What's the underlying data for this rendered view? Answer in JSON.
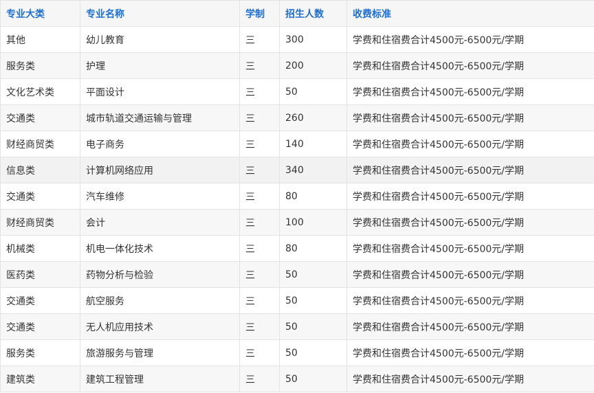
{
  "table": {
    "headers": [
      "专业大类",
      "专业名称",
      "学制",
      "招生人数",
      "收费标准"
    ],
    "rows": [
      [
        "其他",
        "幼儿教育",
        "三",
        "300",
        "学费和住宿费合计4500元-6500元/学期"
      ],
      [
        "服务类",
        "护理",
        "三",
        "200",
        "学费和住宿费合计4500元-6500元/学期"
      ],
      [
        "文化艺术类",
        "平面设计",
        "三",
        "50",
        "学费和住宿费合计4500元-6500元/学期"
      ],
      [
        "交通类",
        "城市轨道交通运输与管理",
        "三",
        "260",
        "学费和住宿费合计4500元-6500元/学期"
      ],
      [
        "财经商贸类",
        "电子商务",
        "三",
        "140",
        "学费和住宿费合计4500元-6500元/学期"
      ],
      [
        "信息类",
        "计算机网络应用",
        "三",
        "340",
        "学费和住宿费合计4500元-6500元/学期"
      ],
      [
        "交通类",
        "汽车维修",
        "三",
        "80",
        "学费和住宿费合计4500元-6500元/学期"
      ],
      [
        "财经商贸类",
        "会计",
        "三",
        "100",
        "学费和住宿费合计4500元-6500元/学期"
      ],
      [
        "机械类",
        "机电一体化技术",
        "三",
        "80",
        "学费和住宿费合计4500元-6500元/学期"
      ],
      [
        "医药类",
        "药物分析与检验",
        "三",
        "50",
        "学费和住宿费合计4500元-6500元/学期"
      ],
      [
        "交通类",
        "航空服务",
        "三",
        "50",
        "学费和住宿费合计4500元-6500元/学期"
      ],
      [
        "交通类",
        "无人机应用技术",
        "三",
        "50",
        "学费和住宿费合计4500元-6500元/学期"
      ],
      [
        "服务类",
        "旅游服务与管理",
        "三",
        "50",
        "学费和住宿费合计4500元-6500元/学期"
      ],
      [
        "建筑类",
        "建筑工程管理",
        "三",
        "50",
        "学费和住宿费合计4500元-6500元/学期"
      ]
    ]
  },
  "colors": {
    "header_text": "#1e6fd0",
    "body_text": "#333333",
    "border": "#e3e3e3"
  }
}
